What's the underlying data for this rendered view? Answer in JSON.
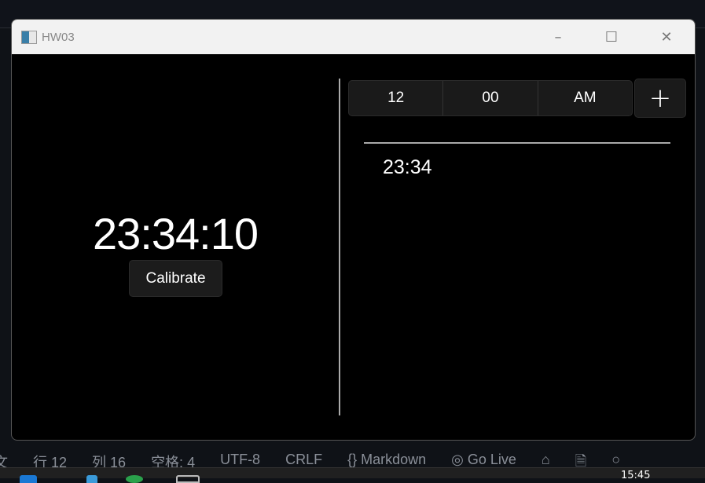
{
  "window": {
    "title": "HW03",
    "minimize": "–",
    "maximize": "☐",
    "close": "✕"
  },
  "clock": {
    "time": "23:34:10",
    "calibrate_label": "Calibrate"
  },
  "picker": {
    "hour": "12",
    "minute": "00",
    "period": "AM",
    "add_label": "+"
  },
  "alarms": [
    {
      "time": "23:34"
    }
  ],
  "statusbar": {
    "items": [
      "文",
      "行 12",
      "列 16",
      "空格: 4",
      "UTF-8",
      "CRLF",
      "{} Markdown",
      "◎ Go Live",
      "⌂",
      "🗎",
      "○"
    ]
  },
  "taskbar": {
    "time": "15:45"
  }
}
